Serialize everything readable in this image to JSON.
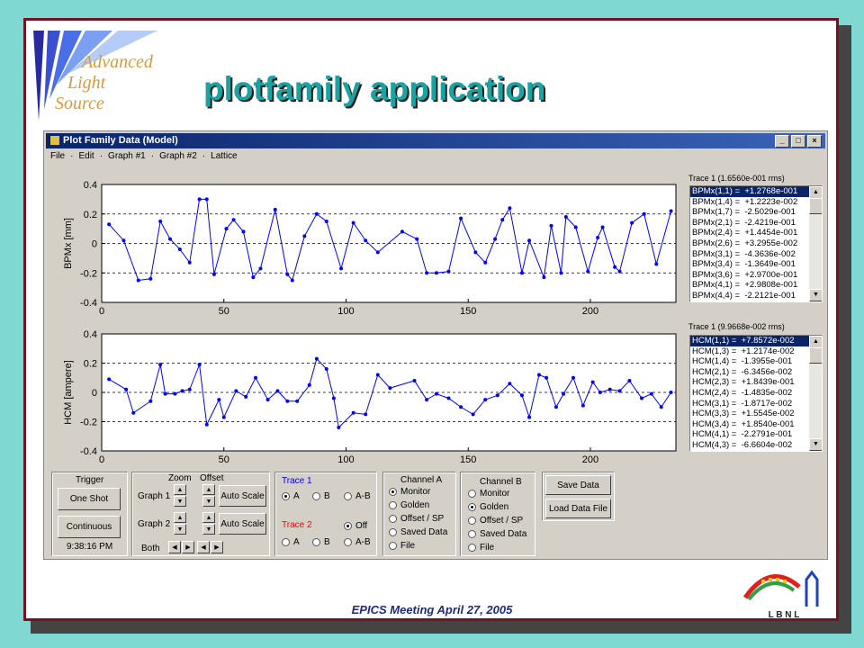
{
  "slide": {
    "title": "plotfamily application",
    "footer": "EPICS Meeting April 27, 2005",
    "logo_words": [
      "Advanced",
      "Light",
      "Source"
    ],
    "lbnl_letters": "L B N L"
  },
  "window": {
    "title": "Plot Family Data (Model)",
    "buttons": [
      "_",
      "□",
      "×"
    ],
    "menu": [
      "File",
      "·",
      "Edit",
      "·",
      "Graph #1",
      "·",
      "Graph #2",
      "·",
      "Lattice"
    ]
  },
  "graph1": {
    "trace_title": "Trace 1 (1.6560e-001 rms)",
    "rows": [
      "BPMx(1,1) =  +1.2768e-001",
      "BPMx(1,4) =  +1.2223e-002",
      "BPMx(1,7) =  -2.5029e-001",
      "BPMx(2,1) =  -2.4219e-001",
      "BPMx(2,4) =  +1.4454e-001",
      "BPMx(2,6) =  +3.2955e-002",
      "BPMx(3,1) =  -4.3636e-002",
      "BPMx(3,4) =  -1.3649e-001",
      "BPMx(3,6) =  +2.9700e-001",
      "BPMx(4,1) =  +2.9808e-001",
      "BPMx(4,4) =  -2.2121e-001"
    ]
  },
  "graph2": {
    "trace_title": "Trace 1 (9.9668e-002 rms)",
    "rows": [
      "HCM(1,1) =  +7.8572e-002",
      "HCM(1,3) =  +1.2174e-002",
      "HCM(1,4) =  -1.3955e-001",
      "HCM(2,1) =  -6.3456e-002",
      "HCM(2,3) =  +1.8439e-001",
      "HCM(2,4) =  -1.4835e-002",
      "HCM(3,1) =  -1.8717e-002",
      "HCM(3,3) =  +1.5545e-002",
      "HCM(3,4) =  +1.8540e-001",
      "HCM(4,1) =  -2.2791e-001",
      "HCM(4,3) =  -6.6604e-002"
    ]
  },
  "controls": {
    "trigger": {
      "label": "Trigger",
      "one_shot": "One Shot",
      "continuous": "Continuous",
      "time": "9:38:16 PM"
    },
    "zoom": {
      "zoom_label": "Zoom",
      "offset_label": "Offset",
      "graph1": "Graph 1",
      "graph2": "Graph 2",
      "both": "Both",
      "auto_scale": "Auto Scale"
    },
    "trace": {
      "trace1_label": "Trace 1",
      "trace2_label": "Trace 2",
      "trace1_options": [
        "A",
        "B",
        "A-B"
      ],
      "trace1_selected": "A",
      "trace2_options": [
        "A",
        "B",
        "A-B"
      ],
      "trace2_off": "Off",
      "trace1_color": "#0000ff",
      "trace2_color": "#ff0000"
    },
    "channel_a": {
      "label": "Channel A",
      "options": [
        "Monitor",
        "Golden",
        "Offset / SP",
        "Saved Data",
        "File"
      ],
      "selected": "Monitor"
    },
    "channel_b": {
      "label": "Channel B",
      "options": [
        "Monitor",
        "Golden",
        "Offset / SP",
        "Saved Data",
        "File"
      ],
      "selected": "Golden"
    },
    "data": {
      "save": "Save Data",
      "load": "Load Data File"
    }
  },
  "chart_data": [
    {
      "type": "line",
      "ylabel": "BPMx [mm]",
      "xlim": [
        0,
        235
      ],
      "ylim": [
        -0.4,
        0.4
      ],
      "xticks": [
        0,
        50,
        100,
        150,
        200
      ],
      "yticks": [
        -0.4,
        -0.2,
        0,
        0.2,
        0.4
      ],
      "ytick_labels": [
        "-0.4",
        "-0.2",
        "0",
        "0.2",
        "0.4"
      ],
      "grid": "dashed horizontal",
      "color": "#0000ff",
      "x": [
        3,
        9,
        15,
        20,
        24,
        28,
        32,
        36,
        40,
        43,
        46,
        51,
        54,
        58,
        62,
        65,
        71,
        76,
        78,
        83,
        88,
        92,
        98,
        103,
        108,
        113,
        123,
        129,
        133,
        137,
        142,
        147,
        153,
        157,
        161,
        164,
        167,
        172,
        175,
        181,
        184,
        188,
        190,
        194,
        199,
        203,
        205,
        210,
        212,
        217,
        222,
        227,
        233
      ],
      "y": [
        0.13,
        0.02,
        -0.25,
        -0.24,
        0.15,
        0.03,
        -0.04,
        -0.13,
        0.3,
        0.3,
        -0.21,
        0.1,
        0.16,
        0.08,
        -0.23,
        -0.17,
        0.23,
        -0.21,
        -0.25,
        0.05,
        0.2,
        0.15,
        -0.17,
        0.14,
        0.02,
        -0.06,
        0.08,
        0.03,
        -0.2,
        -0.2,
        -0.19,
        0.17,
        -0.06,
        -0.13,
        0.03,
        0.16,
        0.24,
        -0.2,
        0.02,
        -0.23,
        0.12,
        -0.2,
        0.18,
        0.11,
        -0.19,
        0.04,
        0.11,
        -0.16,
        -0.19,
        0.14,
        0.2,
        -0.14,
        0.22
      ]
    },
    {
      "type": "line",
      "ylabel": "HCM [ampere]",
      "xlim": [
        0,
        235
      ],
      "ylim": [
        -0.4,
        0.4
      ],
      "xticks": [
        0,
        50,
        100,
        150,
        200
      ],
      "yticks": [
        -0.4,
        -0.2,
        0,
        0.2,
        0.4
      ],
      "ytick_labels": [
        "-0.4",
        "-0.2",
        "0",
        "0.2",
        "0.4"
      ],
      "grid": "dashed horizontal",
      "color": "#0000ff",
      "x": [
        3,
        10,
        13,
        20,
        24,
        26,
        30,
        33,
        36,
        40,
        43,
        48,
        50,
        55,
        59,
        63,
        68,
        72,
        76,
        80,
        85,
        88,
        92,
        95,
        97,
        103,
        108,
        113,
        118,
        128,
        133,
        137,
        142,
        147,
        152,
        157,
        162,
        167,
        172,
        175,
        179,
        182,
        186,
        189,
        193,
        197,
        201,
        204,
        208,
        212,
        216,
        221,
        225,
        229,
        233
      ],
      "y": [
        0.09,
        0.02,
        -0.14,
        -0.06,
        0.19,
        -0.01,
        -0.01,
        0.01,
        0.02,
        0.19,
        -0.22,
        -0.05,
        -0.17,
        0.01,
        -0.03,
        0.1,
        -0.05,
        0.01,
        -0.06,
        -0.06,
        0.05,
        0.23,
        0.16,
        -0.04,
        -0.24,
        -0.14,
        -0.15,
        0.12,
        0.03,
        0.08,
        -0.05,
        -0.01,
        -0.04,
        -0.1,
        -0.15,
        -0.05,
        -0.02,
        0.06,
        -0.02,
        -0.17,
        0.12,
        0.1,
        -0.1,
        -0.01,
        0.1,
        -0.09,
        0.07,
        0.0,
        0.02,
        0.01,
        0.08,
        -0.04,
        -0.01,
        -0.1,
        0.0,
        -0.03,
        -0.03
      ]
    }
  ]
}
